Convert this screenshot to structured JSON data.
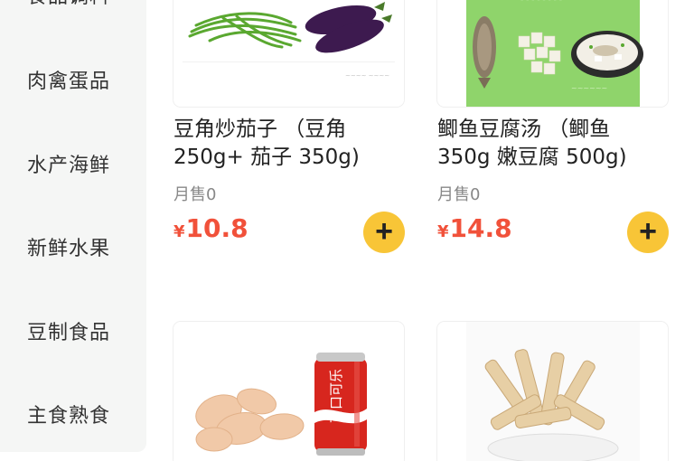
{
  "sidebar": {
    "items": [
      {
        "label": "食品调料"
      },
      {
        "label": "肉禽蛋品"
      },
      {
        "label": "水产海鲜"
      },
      {
        "label": "新鲜水果"
      },
      {
        "label": "豆制食品"
      },
      {
        "label": "主食熟食"
      }
    ]
  },
  "products": [
    {
      "title_line1": "豆角炒茄子 （豆角",
      "title_line2": "250g+ 茄子 350g)",
      "sold": "月售0",
      "currency": "¥",
      "price": "10.8",
      "add": "+"
    },
    {
      "title_line1": "鲫鱼豆腐汤 （鲫鱼",
      "title_line2": "350g 嫩豆腐 500g)",
      "sold": "月售0",
      "currency": "¥",
      "price": "14.8",
      "add": "+"
    },
    {
      "can_text": "可口可乐"
    },
    {}
  ],
  "colors": {
    "accent": "#f8c537",
    "price": "#f1513a",
    "sidebar_bg": "#f5f6f5",
    "fish_bg": "#8fd46b"
  }
}
